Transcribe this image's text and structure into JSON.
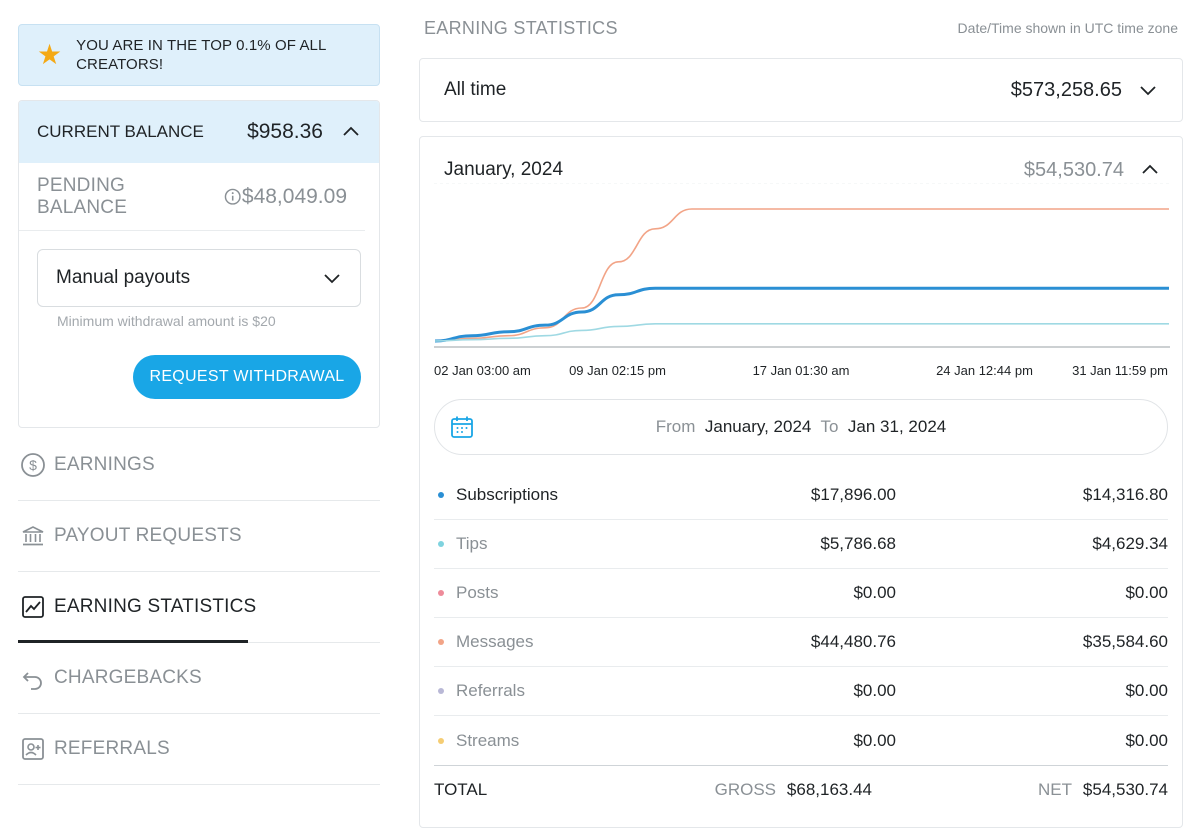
{
  "banner": {
    "icon": "star-icon",
    "text": "YOU ARE IN THE TOP 0.1% OF ALL CREATORS!"
  },
  "balance": {
    "current_label": "CURRENT BALANCE",
    "current_value": "$958.36",
    "pending_label": "PENDING BALANCE",
    "pending_value": "$48,049.09",
    "payout_mode": "Manual payouts",
    "min_note": "Minimum withdrawal amount is $20",
    "withdraw_label": "REQUEST WITHDRAWAL"
  },
  "nav": {
    "items": [
      {
        "label": "EARNINGS",
        "icon": "dollar-circle-icon",
        "active": false
      },
      {
        "label": "PAYOUT REQUESTS",
        "icon": "bank-icon",
        "active": false
      },
      {
        "label": "EARNING STATISTICS",
        "icon": "chart-icon",
        "active": true
      },
      {
        "label": "CHARGEBACKS",
        "icon": "undo-icon",
        "active": false
      },
      {
        "label": "REFERRALS",
        "icon": "user-card-icon",
        "active": false
      }
    ]
  },
  "main": {
    "title": "EARNING STATISTICS",
    "tz_note": "Date/Time shown in UTC time zone",
    "all_time_label": "All time",
    "all_time_value": "$573,258.65",
    "month_label": "January, 2024",
    "month_value": "$54,530.74",
    "range": {
      "from_label": "From",
      "from_value": "January, 2024",
      "to_label": "To",
      "to_value": "Jan 31, 2024"
    },
    "rows": [
      {
        "name": "Subscriptions",
        "gross": "$17,896.00",
        "net": "$14,316.80",
        "color": "#2a8fd4"
      },
      {
        "name": "Tips",
        "gross": "$5,786.68",
        "net": "$4,629.34",
        "color": "#7fd3df"
      },
      {
        "name": "Posts",
        "gross": "$0.00",
        "net": "$0.00",
        "color": "#ee8b9a"
      },
      {
        "name": "Messages",
        "gross": "$44,480.76",
        "net": "$35,584.60",
        "color": "#f2a487"
      },
      {
        "name": "Referrals",
        "gross": "$0.00",
        "net": "$0.00",
        "color": "#b9b8d6"
      },
      {
        "name": "Streams",
        "gross": "$0.00",
        "net": "$0.00",
        "color": "#f5cd74"
      }
    ],
    "total": {
      "label": "TOTAL",
      "gross_label": "GROSS",
      "gross_value": "$68,163.44",
      "net_label": "NET",
      "net_value": "$54,530.74"
    }
  },
  "chart_data": {
    "type": "line",
    "x_labels": [
      "02 Jan 03:00 am",
      "09 Jan 02:15 pm",
      "17 Jan 01:30 am",
      "24 Jan 12:44 pm",
      "31 Jan 11:59 pm"
    ],
    "x": [
      0,
      0.05,
      0.1,
      0.15,
      0.2,
      0.25,
      0.3,
      0.35,
      0.4,
      0.45,
      0.5,
      0.6,
      0.7,
      0.8,
      0.9,
      1.0
    ],
    "series": [
      {
        "name": "Messages",
        "color": "#f2a487",
        "values": [
          0,
          2,
          4,
          10,
          25,
          60,
          85,
          100,
          100,
          100,
          100,
          100,
          100,
          100,
          100,
          100
        ]
      },
      {
        "name": "Subscriptions",
        "color": "#2a8fd4",
        "values": [
          0,
          4,
          7,
          12,
          22,
          35,
          40,
          40,
          40,
          40,
          40,
          40,
          40,
          40,
          40,
          40
        ]
      },
      {
        "name": "Tips",
        "color": "#9fd9e3",
        "values": [
          0,
          1,
          2,
          4,
          8,
          11,
          13,
          13,
          13,
          13,
          13,
          13,
          13,
          13,
          13,
          13
        ]
      }
    ],
    "ylim": [
      0,
      100
    ]
  }
}
